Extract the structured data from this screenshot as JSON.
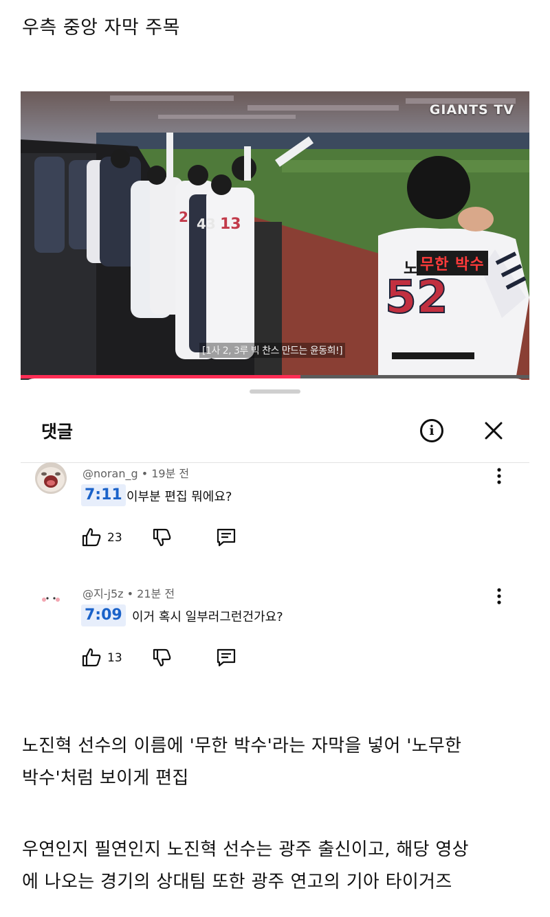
{
  "post": {
    "heading": "우측 중앙 자막 주목",
    "paragraphs": [
      [
        "노진혁 선수의 이름에 '무한 박수'라는 자막을 넣어 '노무한",
        "박수'처럼 보이게 편집"
      ],
      [
        "우연인지 필연인지 노진혁 선수는 광주 출신이고, 해당 영상",
        "에 나오는 경기의 상대팀 또한 광주 연고의 기아 타이거즈"
      ]
    ]
  },
  "video": {
    "channel_logo": "GIANTS TV",
    "subtitle": "[1사 2, 3루 빅 찬스 만드는 윤동희!]",
    "name_prefix": "노",
    "name_caption": "무한 박수",
    "jersey_number": "52",
    "progress": 0.55,
    "accent_color": "#ff2d55"
  },
  "comments_panel": {
    "title": "댓글",
    "info_icon": "info-icon",
    "close_icon": "close-icon",
    "comments": [
      {
        "author": "@noran_g",
        "age": "19분 전",
        "timestamp": "7:11",
        "text": "이부분 편집 뭐에요?",
        "likes": "23",
        "avatar_icon": "crying-cat-avatar"
      },
      {
        "author": "@지-j5z",
        "age": "21분 전",
        "timestamp": "7:09",
        "text": "이거 혹시 일부러그런건가요?",
        "likes": "13",
        "avatar_icon": "blush-face-avatar"
      }
    ]
  }
}
